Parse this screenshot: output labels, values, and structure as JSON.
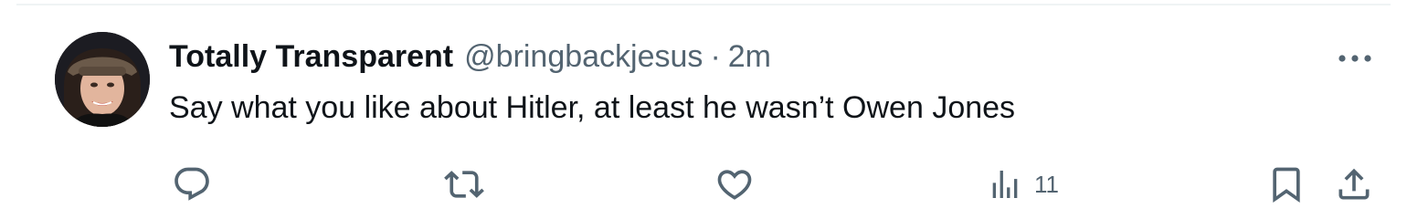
{
  "tweet": {
    "display_name": "Totally Transparent",
    "handle": "@bringbackjesus",
    "separator": "·",
    "time": "2m",
    "text": "Say what you like about Hitler, at least he wasn’t Owen Jones",
    "avatar": "profile-photo",
    "actions": {
      "reply_icon": "reply-icon",
      "retweet_icon": "retweet-icon",
      "like_icon": "heart-icon",
      "views_icon": "views-icon",
      "views_count": "11",
      "bookmark_icon": "bookmark-icon",
      "share_icon": "share-icon",
      "more_icon": "more-icon"
    }
  },
  "colors": {
    "text_primary": "#0f1419",
    "text_secondary": "#536471",
    "border": "#eff3f4"
  }
}
